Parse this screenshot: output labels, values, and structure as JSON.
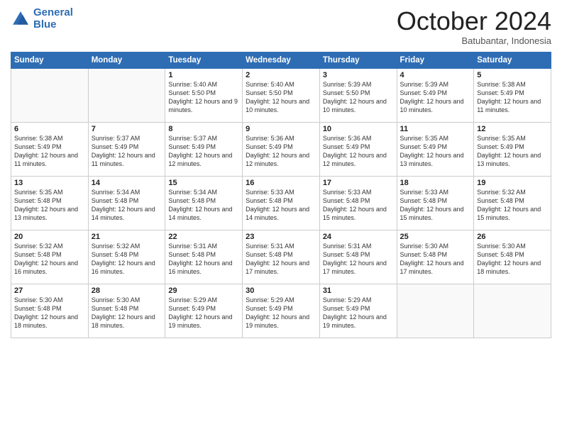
{
  "logo": {
    "line1": "General",
    "line2": "Blue"
  },
  "header": {
    "month": "October 2024",
    "location": "Batubantar, Indonesia"
  },
  "columns": [
    "Sunday",
    "Monday",
    "Tuesday",
    "Wednesday",
    "Thursday",
    "Friday",
    "Saturday"
  ],
  "weeks": [
    [
      {
        "day": "",
        "info": ""
      },
      {
        "day": "",
        "info": ""
      },
      {
        "day": "1",
        "info": "Sunrise: 5:40 AM\nSunset: 5:50 PM\nDaylight: 12 hours and 9 minutes."
      },
      {
        "day": "2",
        "info": "Sunrise: 5:40 AM\nSunset: 5:50 PM\nDaylight: 12 hours and 10 minutes."
      },
      {
        "day": "3",
        "info": "Sunrise: 5:39 AM\nSunset: 5:50 PM\nDaylight: 12 hours and 10 minutes."
      },
      {
        "day": "4",
        "info": "Sunrise: 5:39 AM\nSunset: 5:49 PM\nDaylight: 12 hours and 10 minutes."
      },
      {
        "day": "5",
        "info": "Sunrise: 5:38 AM\nSunset: 5:49 PM\nDaylight: 12 hours and 11 minutes."
      }
    ],
    [
      {
        "day": "6",
        "info": "Sunrise: 5:38 AM\nSunset: 5:49 PM\nDaylight: 12 hours and 11 minutes."
      },
      {
        "day": "7",
        "info": "Sunrise: 5:37 AM\nSunset: 5:49 PM\nDaylight: 12 hours and 11 minutes."
      },
      {
        "day": "8",
        "info": "Sunrise: 5:37 AM\nSunset: 5:49 PM\nDaylight: 12 hours and 12 minutes."
      },
      {
        "day": "9",
        "info": "Sunrise: 5:36 AM\nSunset: 5:49 PM\nDaylight: 12 hours and 12 minutes."
      },
      {
        "day": "10",
        "info": "Sunrise: 5:36 AM\nSunset: 5:49 PM\nDaylight: 12 hours and 12 minutes."
      },
      {
        "day": "11",
        "info": "Sunrise: 5:35 AM\nSunset: 5:49 PM\nDaylight: 12 hours and 13 minutes."
      },
      {
        "day": "12",
        "info": "Sunrise: 5:35 AM\nSunset: 5:49 PM\nDaylight: 12 hours and 13 minutes."
      }
    ],
    [
      {
        "day": "13",
        "info": "Sunrise: 5:35 AM\nSunset: 5:48 PM\nDaylight: 12 hours and 13 minutes."
      },
      {
        "day": "14",
        "info": "Sunrise: 5:34 AM\nSunset: 5:48 PM\nDaylight: 12 hours and 14 minutes."
      },
      {
        "day": "15",
        "info": "Sunrise: 5:34 AM\nSunset: 5:48 PM\nDaylight: 12 hours and 14 minutes."
      },
      {
        "day": "16",
        "info": "Sunrise: 5:33 AM\nSunset: 5:48 PM\nDaylight: 12 hours and 14 minutes."
      },
      {
        "day": "17",
        "info": "Sunrise: 5:33 AM\nSunset: 5:48 PM\nDaylight: 12 hours and 15 minutes."
      },
      {
        "day": "18",
        "info": "Sunrise: 5:33 AM\nSunset: 5:48 PM\nDaylight: 12 hours and 15 minutes."
      },
      {
        "day": "19",
        "info": "Sunrise: 5:32 AM\nSunset: 5:48 PM\nDaylight: 12 hours and 15 minutes."
      }
    ],
    [
      {
        "day": "20",
        "info": "Sunrise: 5:32 AM\nSunset: 5:48 PM\nDaylight: 12 hours and 16 minutes."
      },
      {
        "day": "21",
        "info": "Sunrise: 5:32 AM\nSunset: 5:48 PM\nDaylight: 12 hours and 16 minutes."
      },
      {
        "day": "22",
        "info": "Sunrise: 5:31 AM\nSunset: 5:48 PM\nDaylight: 12 hours and 16 minutes."
      },
      {
        "day": "23",
        "info": "Sunrise: 5:31 AM\nSunset: 5:48 PM\nDaylight: 12 hours and 17 minutes."
      },
      {
        "day": "24",
        "info": "Sunrise: 5:31 AM\nSunset: 5:48 PM\nDaylight: 12 hours and 17 minutes."
      },
      {
        "day": "25",
        "info": "Sunrise: 5:30 AM\nSunset: 5:48 PM\nDaylight: 12 hours and 17 minutes."
      },
      {
        "day": "26",
        "info": "Sunrise: 5:30 AM\nSunset: 5:48 PM\nDaylight: 12 hours and 18 minutes."
      }
    ],
    [
      {
        "day": "27",
        "info": "Sunrise: 5:30 AM\nSunset: 5:48 PM\nDaylight: 12 hours and 18 minutes."
      },
      {
        "day": "28",
        "info": "Sunrise: 5:30 AM\nSunset: 5:48 PM\nDaylight: 12 hours and 18 minutes."
      },
      {
        "day": "29",
        "info": "Sunrise: 5:29 AM\nSunset: 5:49 PM\nDaylight: 12 hours and 19 minutes."
      },
      {
        "day": "30",
        "info": "Sunrise: 5:29 AM\nSunset: 5:49 PM\nDaylight: 12 hours and 19 minutes."
      },
      {
        "day": "31",
        "info": "Sunrise: 5:29 AM\nSunset: 5:49 PM\nDaylight: 12 hours and 19 minutes."
      },
      {
        "day": "",
        "info": ""
      },
      {
        "day": "",
        "info": ""
      }
    ]
  ]
}
